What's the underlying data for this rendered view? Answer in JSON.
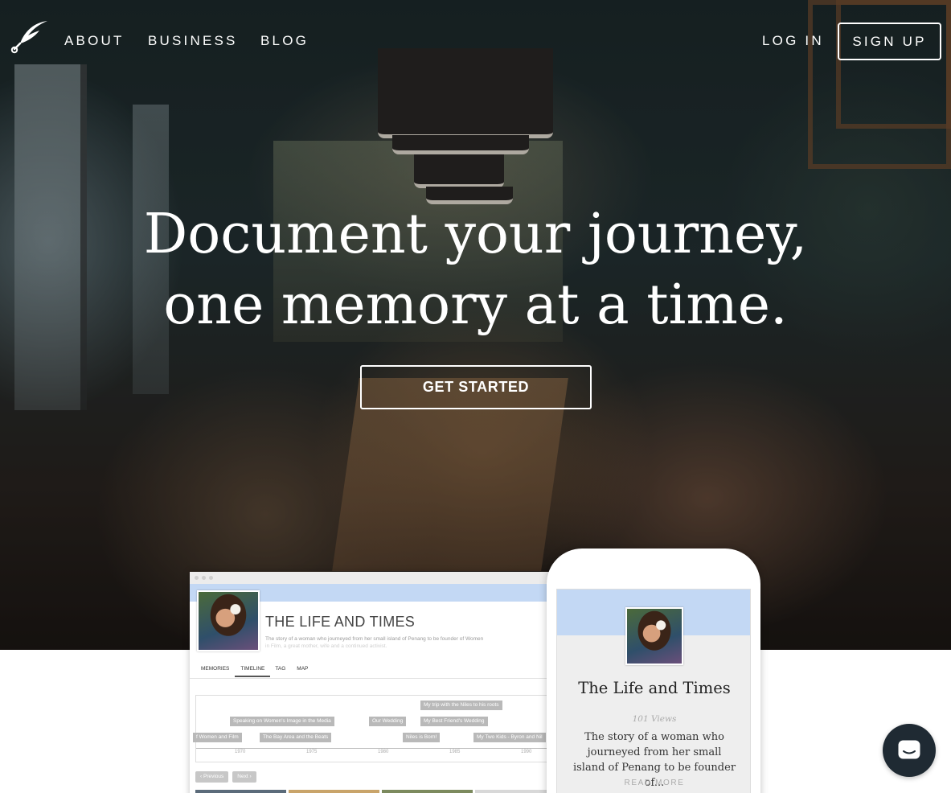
{
  "nav": {
    "links": [
      "ABOUT",
      "BUSINESS",
      "BLOG"
    ],
    "login": "LOG IN",
    "signup": "SIGN UP"
  },
  "hero": {
    "line1": "Document your journey,",
    "line2": "one memory at a time.",
    "cta": "GET STARTED"
  },
  "desktop_preview": {
    "title": "THE LIFE AND TIMES",
    "description_line1": "The story of a woman who journeyed from her small island of Penang to be founder of Women",
    "description_line2": "in Film, a great mother, wife and a continued activist.",
    "tabs": [
      "MEMORIES",
      "TIMELINE",
      "TAG",
      "MAP"
    ],
    "active_tab": "TIMELINE",
    "events": [
      "My trip with the Niles to his roots",
      "Speaking on Women's Image in the Media",
      "Our Wedding",
      "My Best Friend's Wedding",
      "f Women and Film",
      "The Bay Area and the Beats",
      "Niles is Born!",
      "My Two Kids - Byron and Nil"
    ],
    "years": [
      "1970",
      "1975",
      "1980",
      "1985",
      "1990"
    ],
    "prev": "Previous",
    "next": "Next"
  },
  "mobile_preview": {
    "title": "The Life and Times",
    "views": "101 Views",
    "description": "The story of a woman who journeyed from her small island of Penang to be founder of...",
    "read_more": "READ MORE"
  },
  "colors": {
    "banner": "#c3d8f4",
    "chat": "#1f2a33"
  },
  "icons": {
    "logo": "feather-quill-icon",
    "chat": "chat-bubble-icon"
  }
}
